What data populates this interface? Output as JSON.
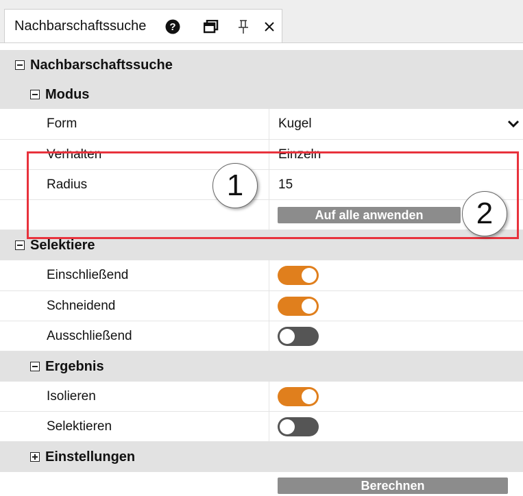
{
  "tab": {
    "title": "Nachbarschaftssuche"
  },
  "sections": {
    "root": "Nachbarschaftssuche",
    "modus": "Modus",
    "selektiere": "Selektiere",
    "ergebnis": "Ergebnis",
    "einstellungen": "Einstellungen"
  },
  "modus": {
    "form_label": "Form",
    "form_value": "Kugel",
    "verhalten_label": "Verhalten",
    "verhalten_value": "Einzeln",
    "radius_label": "Radius",
    "radius_value": "15",
    "apply_all_button": "Auf alle anwenden"
  },
  "selektiere": {
    "items": [
      {
        "label": "Einschließend",
        "on": true
      },
      {
        "label": "Schneidend",
        "on": true
      },
      {
        "label": "Ausschließend",
        "on": false
      }
    ]
  },
  "ergebnis": {
    "items": [
      {
        "label": "Isolieren",
        "on": true
      },
      {
        "label": "Selektieren",
        "on": false
      }
    ]
  },
  "footer": {
    "compute_button": "Berechnen"
  },
  "callouts": [
    "1",
    "2"
  ],
  "colors": {
    "toggle_on": "#e07f1d",
    "toggle_off": "#555555",
    "highlight": "#e8323c"
  }
}
